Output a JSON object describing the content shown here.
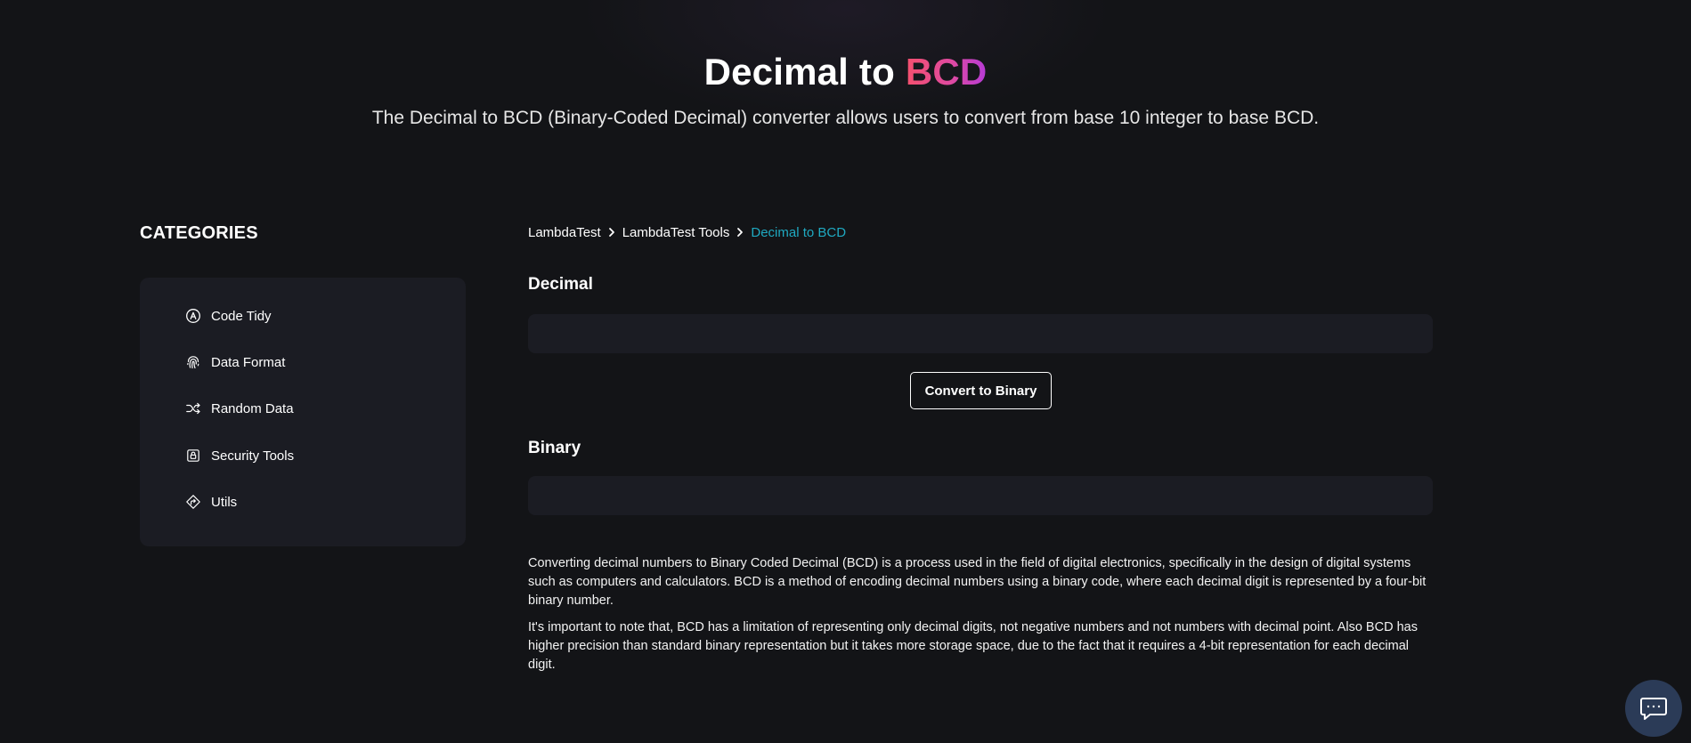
{
  "hero": {
    "title_main": "Decimal to ",
    "title_accent": "BCD",
    "subtitle": "The Decimal to BCD (Binary-Coded Decimal) converter allows users to convert from base 10 integer to base BCD."
  },
  "sidebar": {
    "title": "CATEGORIES",
    "items": [
      {
        "label": "Code Tidy",
        "icon": "code-tidy-icon"
      },
      {
        "label": "Data Format",
        "icon": "fingerprint-icon"
      },
      {
        "label": "Random Data",
        "icon": "shuffle-icon"
      },
      {
        "label": "Security Tools",
        "icon": "lock-icon"
      },
      {
        "label": "Utils",
        "icon": "utils-icon"
      }
    ]
  },
  "breadcrumb": {
    "items": [
      "LambdaTest",
      "LambdaTest Tools",
      "Decimal to BCD"
    ]
  },
  "form": {
    "decimal_label": "Decimal",
    "decimal_value": "",
    "convert_label": "Convert to Binary",
    "binary_label": "Binary",
    "binary_value": ""
  },
  "description": {
    "paragraph1": "Converting decimal numbers to Binary Coded Decimal (BCD) is a process used in the field of digital electronics, specifically in the design of digital systems such as computers and calculators. BCD is a method of encoding decimal numbers using a binary code, where each decimal digit is represented by a four-bit binary number.",
    "paragraph2": "It's important to note that, BCD has a limitation of representing only decimal digits, not negative numbers and not numbers with decimal point. Also BCD has higher precision than standard binary representation but it takes more storage space, due to the fact that it requires a 4-bit representation for each decimal digit."
  },
  "colors": {
    "background": "#131417",
    "panel": "#1b1c23",
    "breadcrumb_current": "#1fa9c1",
    "accent_start": "#f5506e",
    "accent_end": "#b63bd6",
    "chat_button": "#2b3b57"
  },
  "chat": {
    "icon": "chat-bubble-icon"
  }
}
